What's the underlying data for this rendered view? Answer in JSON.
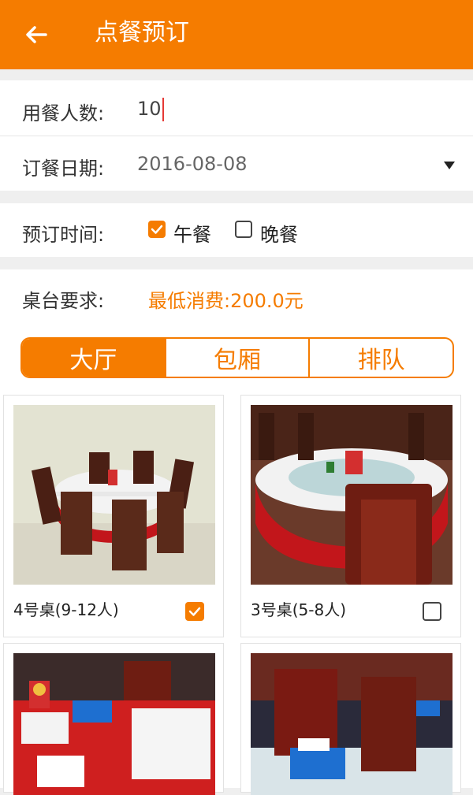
{
  "header": {
    "title": "点餐预订",
    "back_icon": "arrow-left-icon",
    "bg_color": "#f57c00"
  },
  "form": {
    "guests": {
      "label": "用餐人数:",
      "value": "10"
    },
    "date": {
      "label": "订餐日期:",
      "value": "2016-08-08",
      "icon": "dropdown-triangle-icon"
    },
    "time": {
      "label": "预订时间:",
      "options": [
        {
          "label": "午餐",
          "checked": true
        },
        {
          "label": "晚餐",
          "checked": false
        }
      ]
    },
    "table_req": {
      "label": "桌台要求:",
      "min_charge": "最低消费:200.0元"
    }
  },
  "tabs": [
    {
      "label": "大厅",
      "active": true
    },
    {
      "label": "包厢",
      "active": false
    },
    {
      "label": "排队",
      "active": false
    }
  ],
  "tables": [
    {
      "label": "4号桌(9-12人)",
      "checked": true
    },
    {
      "label": "3号桌(5-8人)",
      "checked": false
    },
    {
      "label": "",
      "checked": false
    },
    {
      "label": "",
      "checked": false
    }
  ]
}
